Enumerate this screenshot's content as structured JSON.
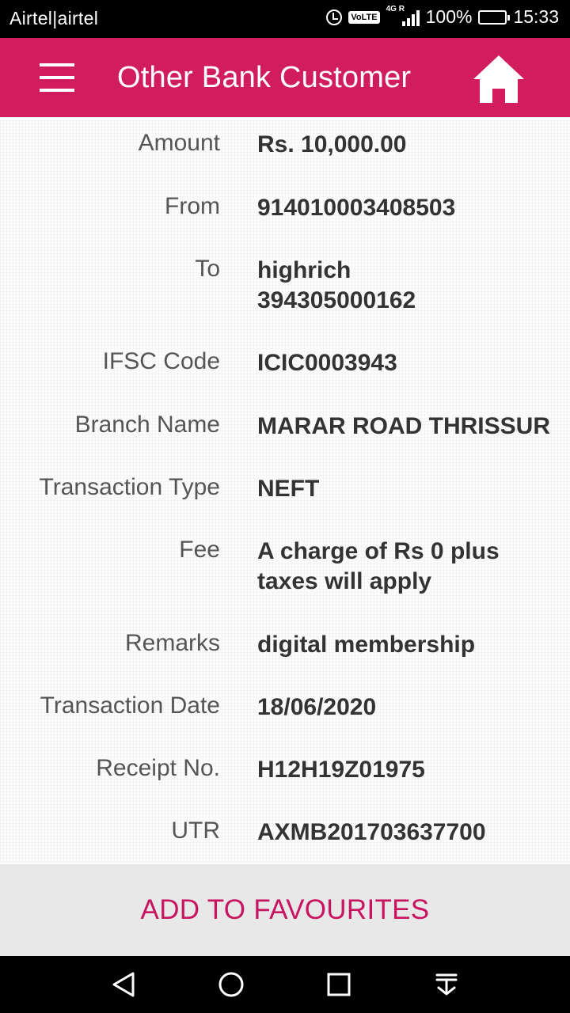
{
  "status_bar": {
    "carrier": "Airtel|airtel",
    "volte": "VoLTE",
    "network": "4G R",
    "battery": "100%",
    "battery_level": 1.0,
    "time": "15:33"
  },
  "app_bar": {
    "title": "Other Bank Customer"
  },
  "details": [
    {
      "label": "Amount",
      "value": "Rs. 10,000.00"
    },
    {
      "label": "From",
      "value": "914010003408503"
    },
    {
      "label": "To",
      "value": "highrich 394305000162"
    },
    {
      "label": "IFSC Code",
      "value": "ICIC0003943"
    },
    {
      "label": "Branch Name",
      "value": "MARAR ROAD THRISSUR"
    },
    {
      "label": "Transaction Type",
      "value": "NEFT"
    },
    {
      "label": "Fee",
      "value": "A charge of Rs 0 plus taxes will apply"
    },
    {
      "label": "Remarks",
      "value": "digital membership"
    },
    {
      "label": "Transaction Date",
      "value": "18/06/2020"
    },
    {
      "label": "Receipt No.",
      "value": "H12H19Z01975"
    },
    {
      "label": "UTR",
      "value": "AXMB201703637700"
    }
  ],
  "footer": {
    "button_label": "ADD TO FAVOURITES"
  },
  "colors": {
    "brand": "#d11c5e",
    "button_text": "#c8155f",
    "battery": "#28d94b"
  },
  "icons": {
    "menu": "hamburger-menu-icon",
    "home": "home-icon",
    "nav_back": "back-triangle-icon",
    "nav_home": "home-circle-icon",
    "nav_recents": "recents-square-icon",
    "nav_notifications": "pull-down-icon"
  }
}
